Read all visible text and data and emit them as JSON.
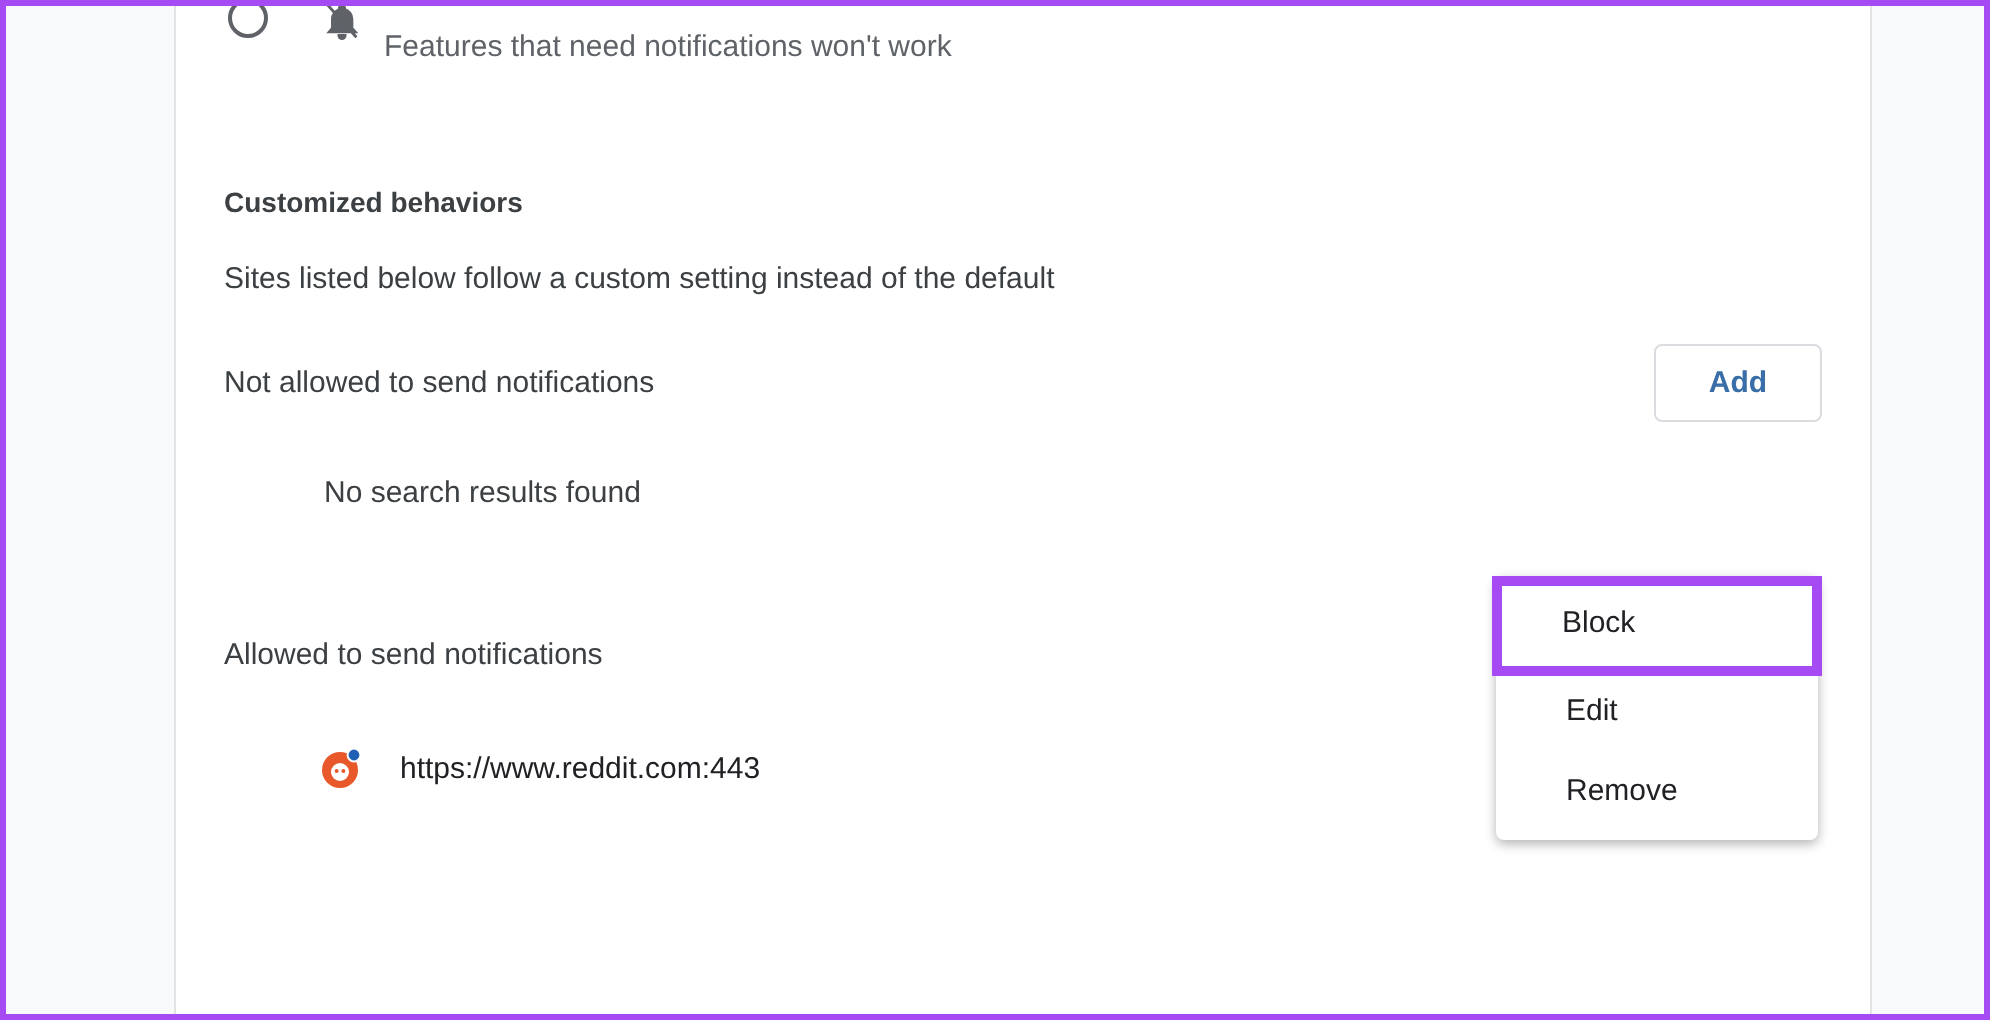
{
  "blocked_option": {
    "selected": false,
    "description": "Features that need notifications won't work"
  },
  "customized": {
    "heading": "Customized behaviors",
    "description": "Sites listed below follow a custom setting instead of the default"
  },
  "not_allowed": {
    "label": "Not allowed to send notifications",
    "add_button": "Add",
    "empty_message": "No search results found"
  },
  "allowed": {
    "label": "Allowed to send notifications",
    "sites": [
      {
        "url": "https://www.reddit.com:443"
      }
    ]
  },
  "context_menu": {
    "items": [
      {
        "label": "Block",
        "highlighted": true
      },
      {
        "label": "Edit",
        "highlighted": false
      },
      {
        "label": "Remove",
        "highlighted": false
      }
    ]
  }
}
